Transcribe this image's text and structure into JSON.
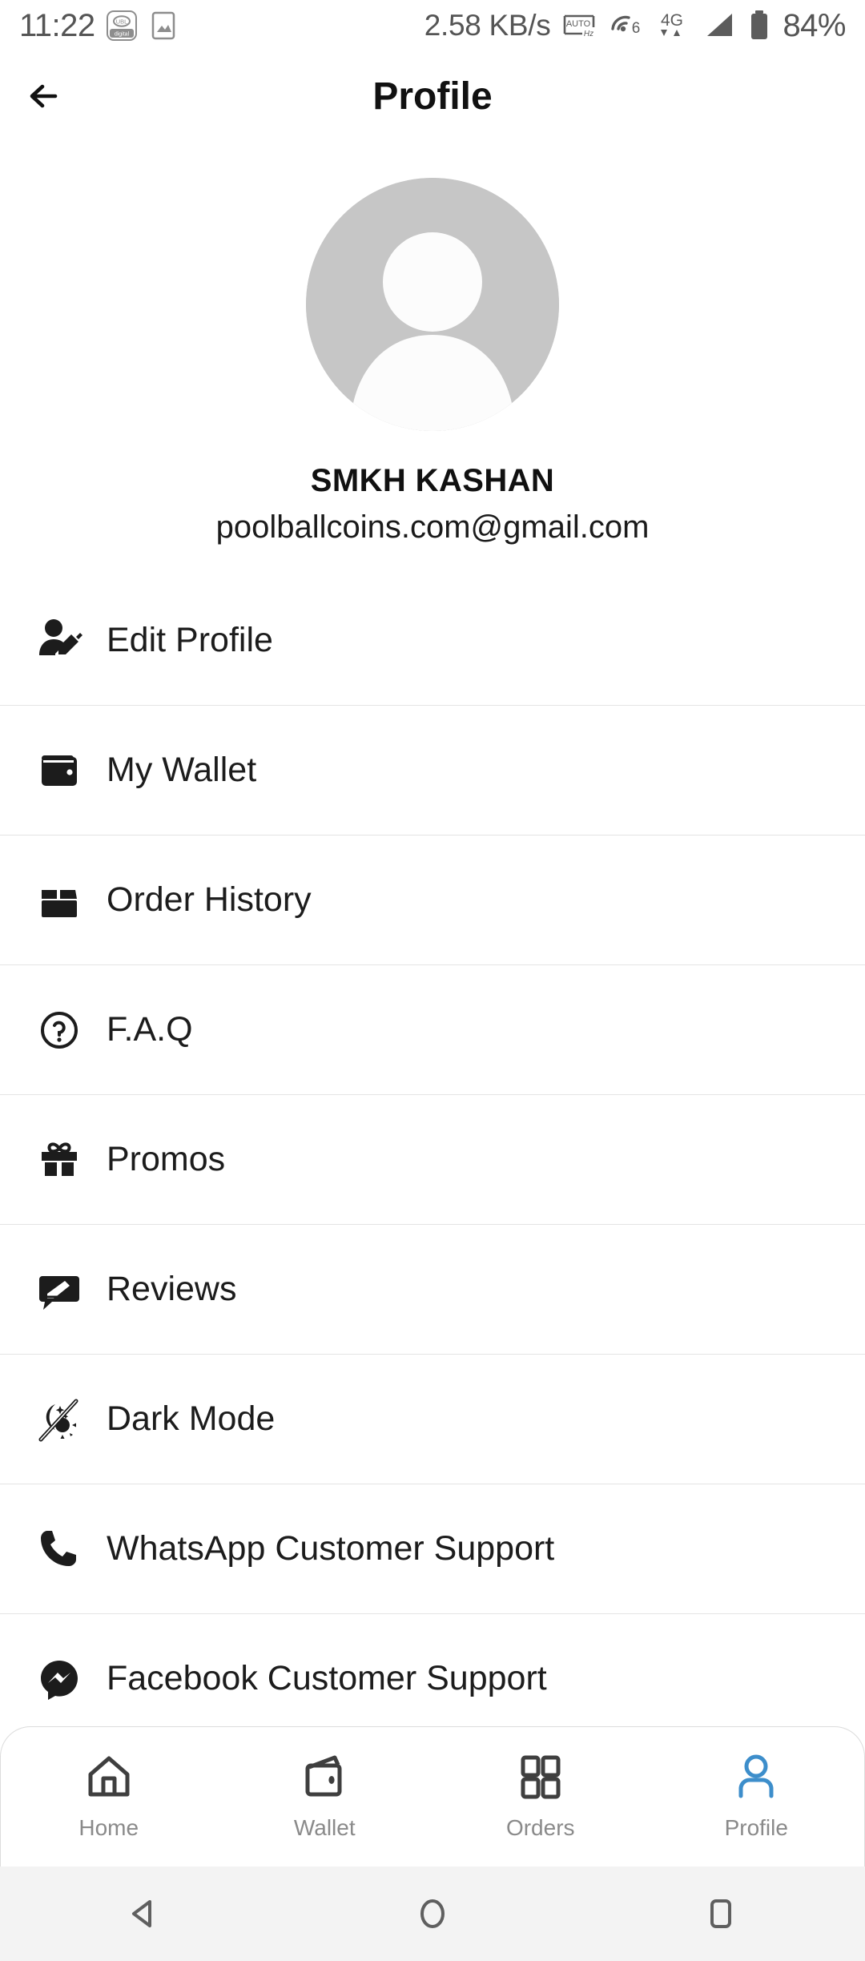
{
  "statusbar": {
    "time": "11:22",
    "app_icons": [
      {
        "name": "ubl-digital-icon",
        "label": "UBL digital"
      },
      {
        "name": "gallery-icon",
        "label": "Gallery"
      }
    ],
    "network_speed": "2.58 KB/s",
    "indicators": [
      {
        "name": "auto-hz-icon",
        "label": "AUTO Hz"
      },
      {
        "name": "wifi-6-icon",
        "label": "WiFi 6"
      },
      {
        "name": "mobile-data-4g-icon",
        "label": "4G"
      },
      {
        "name": "signal-bars-icon",
        "label": "Signal"
      },
      {
        "name": "battery-icon",
        "label": "Battery"
      }
    ],
    "battery_percent": "84%"
  },
  "header": {
    "back_label": "Back",
    "title": "Profile"
  },
  "profile": {
    "avatar_alt": "Default profile picture",
    "name": "SMKH KASHAN",
    "email": "poolballcoins.com@gmail.com"
  },
  "menu": {
    "items": [
      {
        "icon": "user-edit-icon",
        "label": "Edit Profile"
      },
      {
        "icon": "wallet-icon",
        "label": "My Wallet"
      },
      {
        "icon": "box-icon",
        "label": "Order History"
      },
      {
        "icon": "question-circle-icon",
        "label": "F.A.Q"
      },
      {
        "icon": "gift-icon",
        "label": "Promos"
      },
      {
        "icon": "review-bubble-icon",
        "label": "Reviews"
      },
      {
        "icon": "dark-mode-icon",
        "label": "Dark Mode"
      },
      {
        "icon": "phone-icon",
        "label": "WhatsApp Customer Support"
      },
      {
        "icon": "messenger-icon",
        "label": "Facebook Customer Support"
      }
    ]
  },
  "bottom_nav": {
    "active_color": "#3d8ecb",
    "inactive_color": "#3f3f3f",
    "label_color": "#8a8a8a",
    "items": [
      {
        "icon": "home-icon",
        "label": "Home",
        "active": false
      },
      {
        "icon": "wallet-outline-icon",
        "label": "Wallet",
        "active": false
      },
      {
        "icon": "grid-icon",
        "label": "Orders",
        "active": false
      },
      {
        "icon": "person-icon",
        "label": "Profile",
        "active": true
      }
    ]
  },
  "android_nav": {
    "back_label": "Back",
    "home_label": "Home",
    "recents_label": "Recents"
  }
}
